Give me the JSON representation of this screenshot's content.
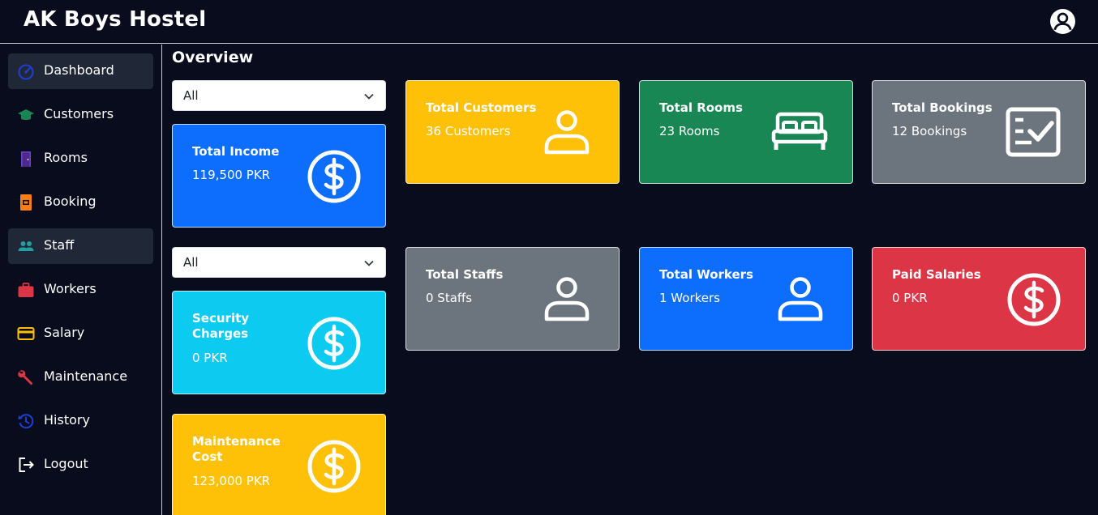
{
  "header": {
    "brand": "AK Boys Hostel",
    "user_icon": "user-circle-icon"
  },
  "sidebar": {
    "items": [
      {
        "label": "Dashboard",
        "icon": "speedometer-icon",
        "color": "#1d3fd6",
        "active": true
      },
      {
        "label": "Customers",
        "icon": "graduation-cap-icon",
        "color": "#198754",
        "active": false
      },
      {
        "label": "Rooms",
        "icon": "door-icon",
        "color": "#6f42c1",
        "active": false
      },
      {
        "label": "Booking",
        "icon": "booking-icon",
        "color": "#fd7e14",
        "active": false
      },
      {
        "label": "Staff",
        "icon": "people-icon",
        "color": "#20a0a0",
        "active": true
      },
      {
        "label": "Workers",
        "icon": "briefcase-icon",
        "color": "#dc3545",
        "active": false
      },
      {
        "label": "Salary",
        "icon": "credit-card-icon",
        "color": "#ffc107",
        "active": false
      },
      {
        "label": "Maintenance",
        "icon": "wrench-icon",
        "color": "#dc3545",
        "active": false
      },
      {
        "label": "History",
        "icon": "history-icon",
        "color": "#1d3fd6",
        "active": false
      },
      {
        "label": "Logout",
        "icon": "logout-icon",
        "color": "#ffffff",
        "active": false
      }
    ]
  },
  "main": {
    "title": "Overview",
    "filters": [
      {
        "value": "All"
      },
      {
        "value": "All"
      }
    ],
    "cards": {
      "total_income": {
        "title": "Total Income",
        "value": "119,500 PKR",
        "color": "#0d6efd",
        "icon": "dollar-circle-icon"
      },
      "security_charges": {
        "title": "Security Charges",
        "value": "0 PKR",
        "color": "#0dcaf0",
        "icon": "dollar-circle-icon"
      },
      "maintenance_cost": {
        "title": "Maintenance Cost",
        "value": "123,000 PKR",
        "color": "#ffc107",
        "icon": "dollar-circle-icon"
      },
      "total_customers": {
        "title": "Total Customers",
        "value": "36 Customers",
        "color": "#ffc107",
        "icon": "person-icon"
      },
      "total_rooms": {
        "title": "Total Rooms",
        "value": "23 Rooms",
        "color": "#198754",
        "icon": "bed-icon"
      },
      "total_bookings": {
        "title": "Total Bookings",
        "value": "12 Bookings",
        "color": "#6c757d",
        "icon": "checklist-icon"
      },
      "total_staffs": {
        "title": "Total Staffs",
        "value": "0 Staffs",
        "color": "#6c757d",
        "icon": "person-icon"
      },
      "total_workers": {
        "title": "Total Workers",
        "value": "1 Workers",
        "color": "#0d6efd",
        "icon": "person-icon"
      },
      "paid_salaries": {
        "title": "Paid Salaries",
        "value": "0 PKR",
        "color": "#dc3545",
        "icon": "dollar-circle-icon"
      }
    }
  }
}
